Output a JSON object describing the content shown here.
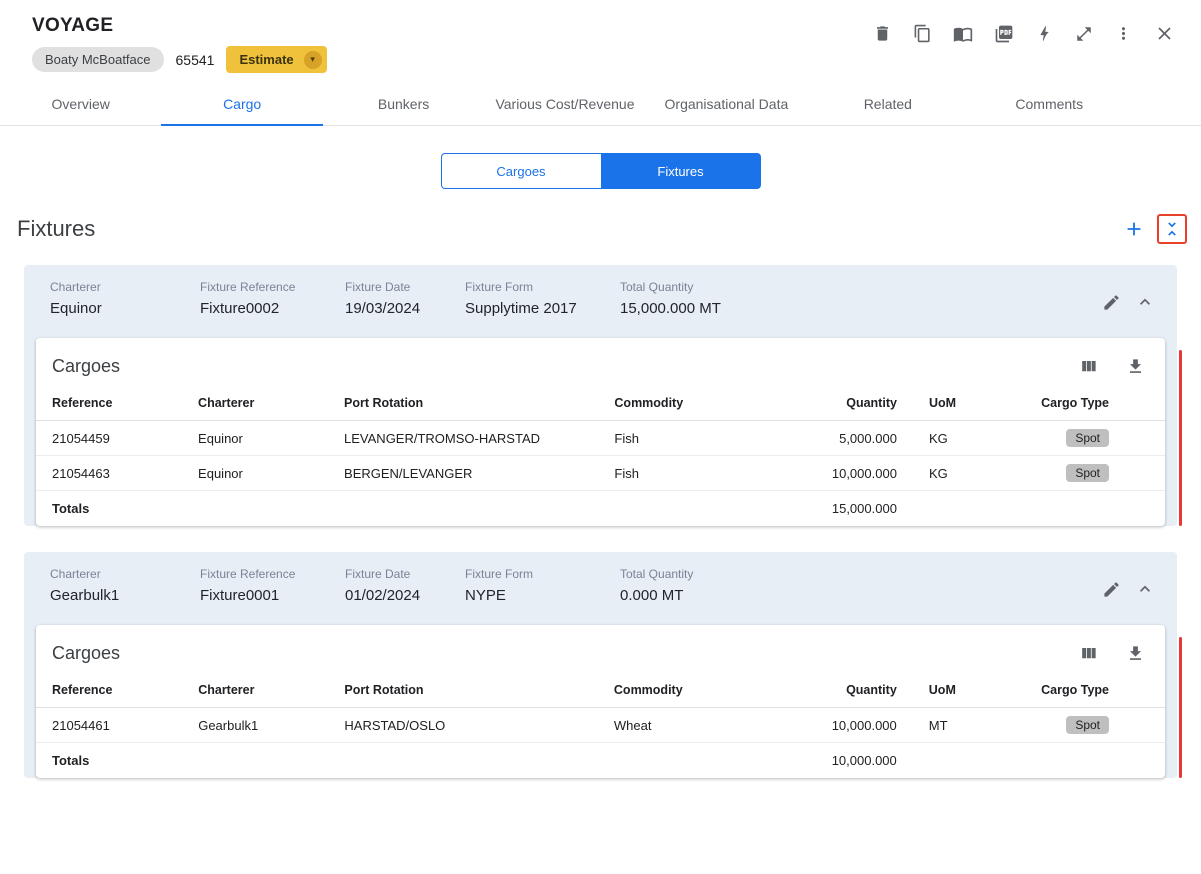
{
  "colors": {
    "accent_blue": "#1a73e8",
    "estimate_yellow": "#f0c13a",
    "alert_red": "#e53935",
    "fixture_header_blue": "#e8eef6"
  },
  "icons": {
    "caret_down": "▾"
  },
  "header": {
    "title": "VOYAGE",
    "vessel_name": "Boaty McBoatface",
    "voyage_number": "65541",
    "estimate_label": "Estimate"
  },
  "tabs": [
    {
      "label": "Overview",
      "active": false
    },
    {
      "label": "Cargo",
      "active": true
    },
    {
      "label": "Bunkers",
      "active": false
    },
    {
      "label": "Various Cost/Revenue",
      "active": false
    },
    {
      "label": "Organisational Data",
      "active": false
    },
    {
      "label": "Related",
      "active": false
    },
    {
      "label": "Comments",
      "active": false
    }
  ],
  "view_toggle": {
    "cargoes_label": "Cargoes",
    "fixtures_label": "Fixtures",
    "selected": "Fixtures"
  },
  "section": {
    "title": "Fixtures"
  },
  "field_labels": {
    "charterer": "Charterer",
    "fixture_reference": "Fixture Reference",
    "fixture_date": "Fixture Date",
    "fixture_form": "Fixture Form",
    "total_quantity": "Total Quantity"
  },
  "cargo_table": {
    "title": "Cargoes",
    "columns": [
      "Reference",
      "Charterer",
      "Port Rotation",
      "Commodity",
      "Quantity",
      "UoM",
      "Cargo Type"
    ],
    "totals_label": "Totals"
  },
  "fixtures": [
    {
      "charterer": "Equinor",
      "fixture_reference": "Fixture0002",
      "fixture_date": "19/03/2024",
      "fixture_form": "Supplytime 2017",
      "total_quantity": "15,000.000 MT",
      "rows": [
        {
          "reference": "21054459",
          "charterer": "Equinor",
          "port_rotation": "LEVANGER/TROMSO-HARSTAD",
          "commodity": "Fish",
          "quantity": "5,000.000",
          "uom": "KG",
          "cargo_type": "Spot"
        },
        {
          "reference": "21054463",
          "charterer": "Equinor",
          "port_rotation": "BERGEN/LEVANGER",
          "commodity": "Fish",
          "quantity": "10,000.000",
          "uom": "KG",
          "cargo_type": "Spot"
        }
      ],
      "totals_quantity": "15,000.000"
    },
    {
      "charterer": "Gearbulk1",
      "fixture_reference": "Fixture0001",
      "fixture_date": "01/02/2024",
      "fixture_form": "NYPE",
      "total_quantity": "0.000 MT",
      "rows": [
        {
          "reference": "21054461",
          "charterer": "Gearbulk1",
          "port_rotation": "HARSTAD/OSLO",
          "commodity": "Wheat",
          "quantity": "10,000.000",
          "uom": "MT",
          "cargo_type": "Spot"
        }
      ],
      "totals_quantity": "10,000.000"
    }
  ]
}
